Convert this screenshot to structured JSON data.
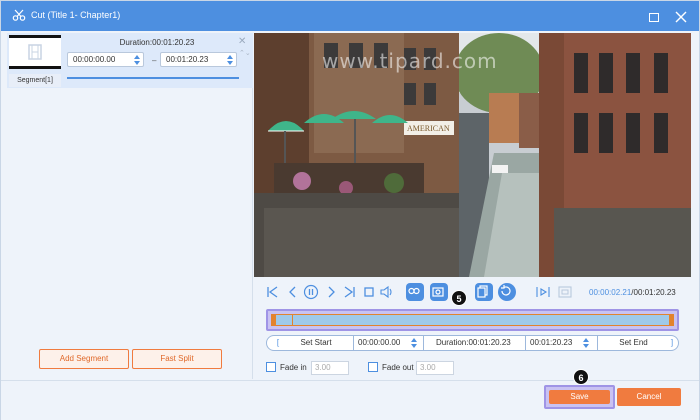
{
  "window": {
    "title": "Cut (Title 1- Chapter1)",
    "title_icon": "scissors-icon",
    "maximize_icon": "maximize-icon",
    "close_icon": "close-icon"
  },
  "segment_panel": {
    "duration_label": "Duration:00:01:20.23",
    "start_time": "00:00:00.00",
    "end_time": "00:01:20.23",
    "separator": "–",
    "segment_label": "Segment[1]",
    "close_glyph": "✕",
    "reorder_glyphs": "⌃⌄"
  },
  "left_buttons": {
    "add_segment": "Add Segment",
    "fast_split": "Fast Split"
  },
  "video": {
    "watermark": "www.tipard.com",
    "sign": "AMERICAN"
  },
  "player": {
    "current_time": "00:00:02.21",
    "total_time": "/00:01:20.23",
    "icons": [
      "skip-start-icon",
      "prev-frame-icon",
      "pause-icon",
      "next-frame-icon",
      "skip-end-icon",
      "stop-icon",
      "volume-icon",
      "loop-icon",
      "snapshot-icon",
      "copy-icon",
      "reset-icon",
      "play-segment-icon",
      "preview-icon"
    ]
  },
  "badges": {
    "timeline_step": "5",
    "save_step": "6"
  },
  "edit_row": {
    "set_start": "Set Start",
    "start_value": "00:00:00.00",
    "duration": "Duration:00:01:20.23",
    "end_value": "00:01:20.23",
    "set_end": "Set End"
  },
  "fade": {
    "fade_in_label": "Fade in",
    "fade_in_value": "3.00",
    "fade_out_label": "Fade out",
    "fade_out_value": "3.00"
  },
  "footer": {
    "save": "Save",
    "cancel": "Cancel"
  },
  "colors": {
    "accent_blue": "#4d8fe0",
    "accent_orange": "#f07b3f",
    "highlight_purple": "#9f94e6"
  }
}
